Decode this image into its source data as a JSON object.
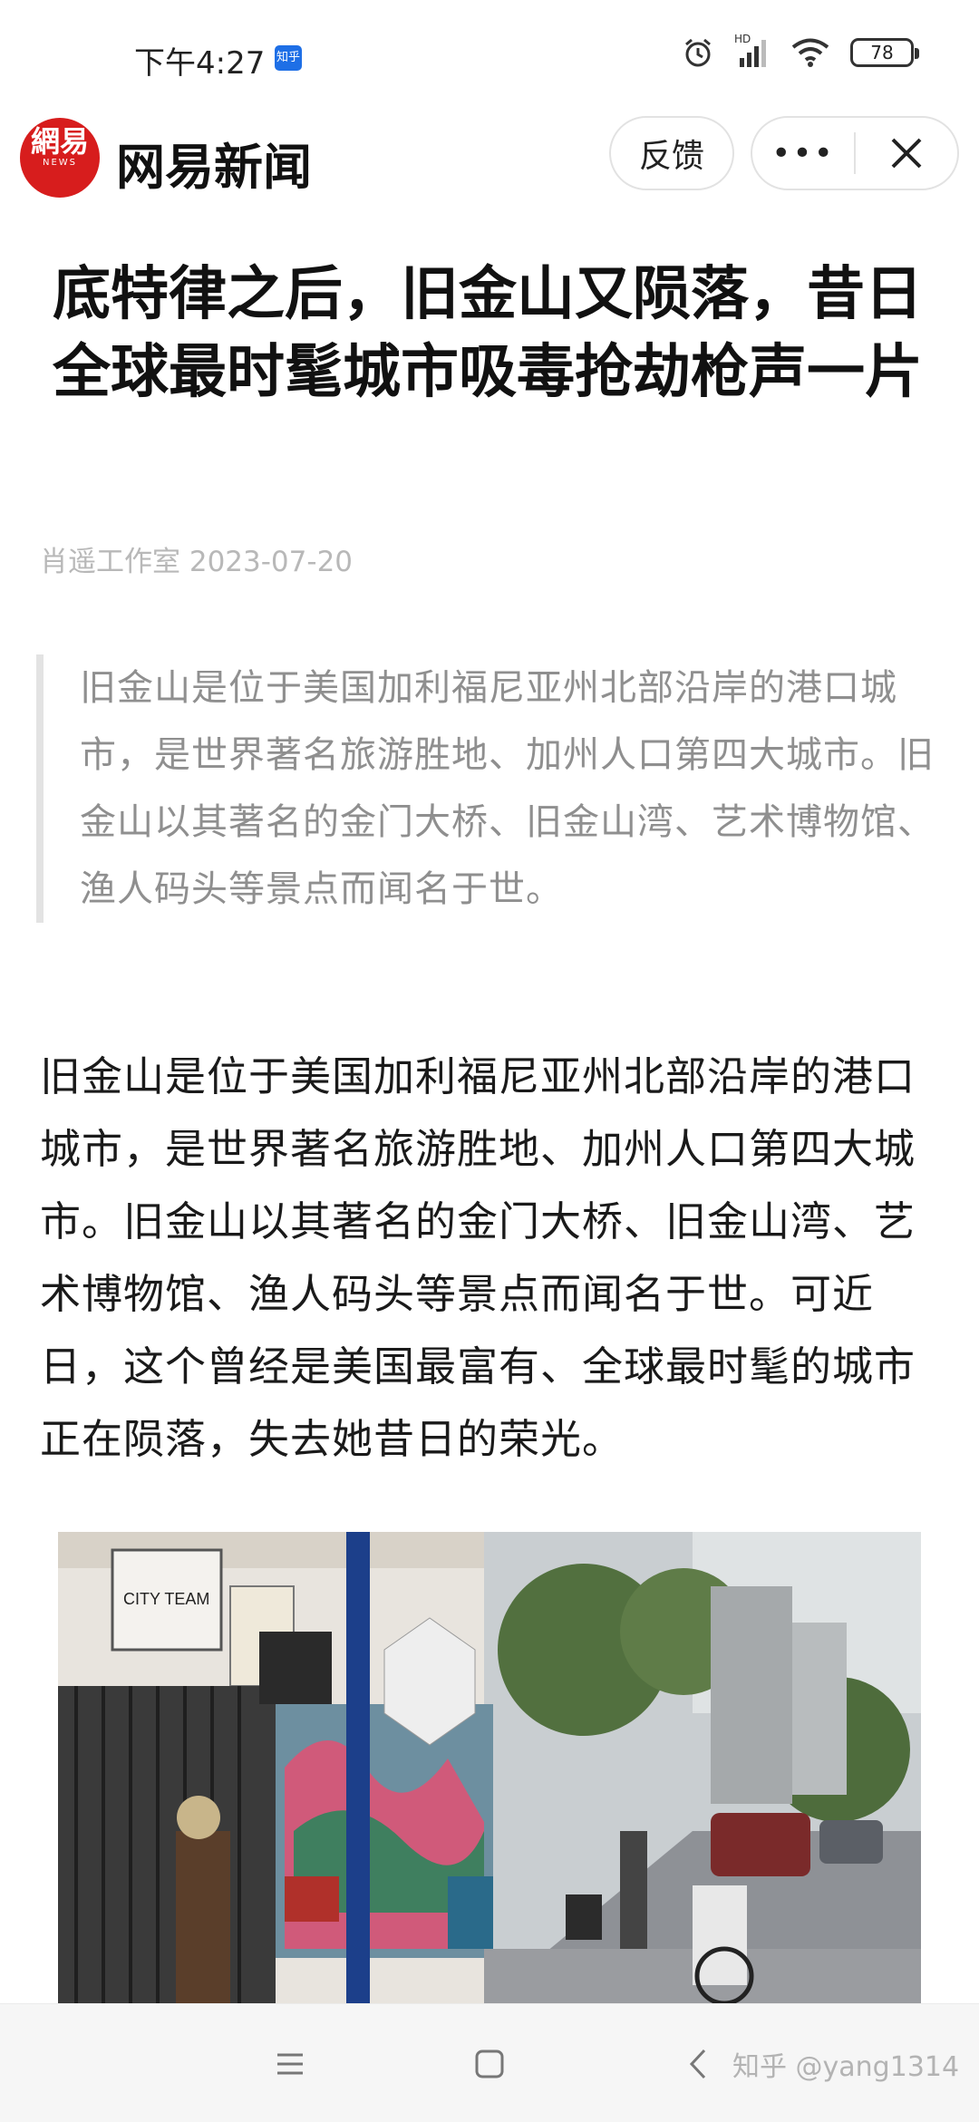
{
  "status_bar": {
    "time": "下午4:27",
    "app_badge": "知乎",
    "battery": "78",
    "network_label": "HD"
  },
  "app_header": {
    "logo_text": "網易",
    "logo_sub": "NEWS",
    "title": "网易新闻",
    "feedback_label": "反馈",
    "more_label": "•••",
    "accent_color": "#d71d1d"
  },
  "article": {
    "title": "底特律之后，旧金山又陨落，昔日全球最时髦城市吸毒抢劫枪声一片",
    "byline": "肖遥工作室 2023-07-20",
    "summary": "旧金山是位于美国加利福尼亚州北部沿岸的港口城市，是世界著名旅游胜地、加州人口第四大城市。旧金山以其著名的金门大桥、旧金山湾、艺术博物馆、渔人码头等景点而闻名于世。",
    "body": "旧金山是位于美国加利福尼亚州北部沿岸的港口城市，是世界著名旅游胜地、加州人口第四大城市。旧金山以其著名的金门大桥、旧金山湾、艺术博物馆、渔人码头等景点而闻名于世。可近日，这个曾经是美国最富有、全球最时髦的城市正在陨落，失去她昔日的荣光。",
    "photo_sign": "CITY TEAM"
  },
  "bottom_nav": {
    "watermark": "知乎 @yang1314"
  }
}
